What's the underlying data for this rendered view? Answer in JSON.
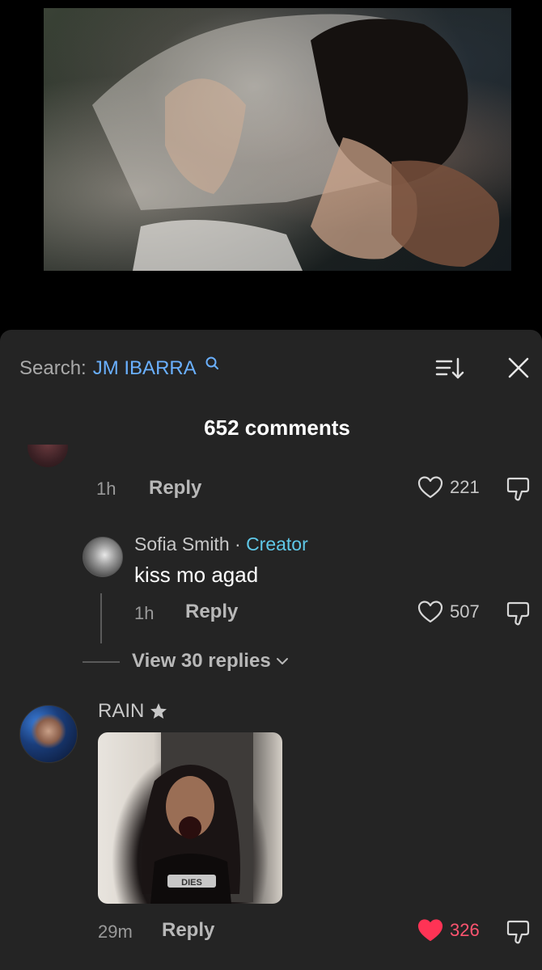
{
  "search": {
    "prefix": "Search:",
    "term": "JM IBARRA"
  },
  "comments_count": "652 comments",
  "partial_comment": {
    "time": "1h",
    "reply_label": "Reply",
    "likes": "221"
  },
  "sofia_reply": {
    "author": "Sofia Smith",
    "separator": "·",
    "badge": "Creator",
    "text": "kiss mo agad",
    "time": "1h",
    "reply_label": "Reply",
    "likes": "507"
  },
  "view_replies": "View 30 replies",
  "rain_comment": {
    "author": "RAIN",
    "time": "29m",
    "reply_label": "Reply",
    "likes": "326",
    "liked": true,
    "gif_text": "DIES"
  },
  "colors": {
    "sheet_bg": "#242424",
    "search_term": "#6ab0ff",
    "creator_badge": "#5fc8e8",
    "liked_heart": "#ff3355"
  },
  "icons": [
    "search-icon",
    "sort-icon",
    "close-icon",
    "heart-icon",
    "dislike-icon",
    "chevron-down-icon",
    "star-icon"
  ]
}
